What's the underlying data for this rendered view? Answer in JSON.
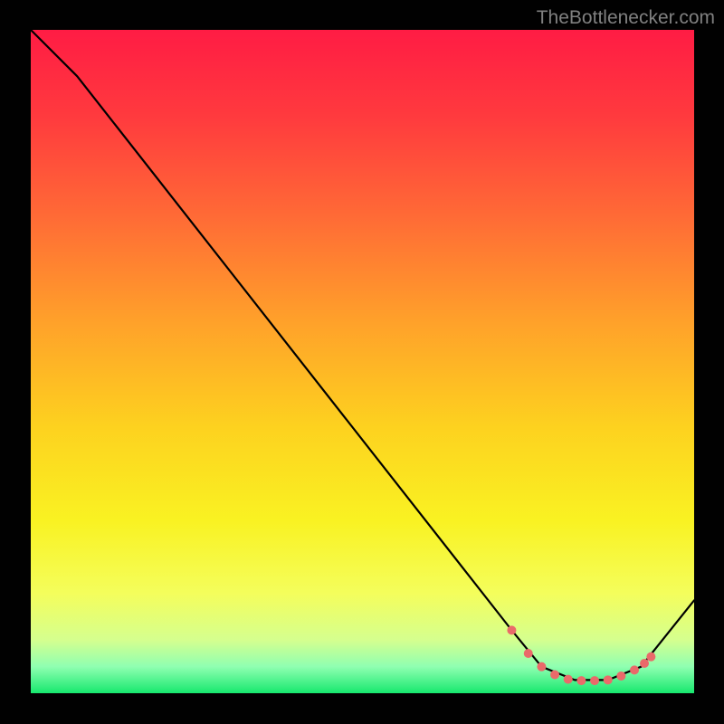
{
  "watermark": "TheBottlenecker.com",
  "chart_data": {
    "type": "line",
    "title": "",
    "xlabel": "",
    "ylabel": "",
    "xlim": [
      0,
      100
    ],
    "ylim": [
      0,
      100
    ],
    "series": [
      {
        "name": "curve",
        "x": [
          0,
          7,
          72.5,
          77,
          82,
          87,
          92,
          100
        ],
        "y": [
          100,
          93,
          9.5,
          4,
          2,
          2,
          4,
          14
        ]
      }
    ],
    "markers": {
      "name": "highlight-points",
      "color": "#ea6a6a",
      "x": [
        72.5,
        75,
        77,
        79,
        81,
        83,
        85,
        87,
        89,
        91,
        92.5,
        93.5
      ],
      "y": [
        9.5,
        6.0,
        4.0,
        2.8,
        2.1,
        1.9,
        1.9,
        2.0,
        2.6,
        3.5,
        4.5,
        5.5
      ]
    },
    "gradient": {
      "stops": [
        {
          "offset": 0.0,
          "color": "#ff1c44"
        },
        {
          "offset": 0.13,
          "color": "#ff3a3e"
        },
        {
          "offset": 0.28,
          "color": "#ff6a36"
        },
        {
          "offset": 0.44,
          "color": "#ffa12a"
        },
        {
          "offset": 0.6,
          "color": "#fdd21f"
        },
        {
          "offset": 0.74,
          "color": "#f9f222"
        },
        {
          "offset": 0.85,
          "color": "#f4fe5c"
        },
        {
          "offset": 0.92,
          "color": "#d5ff8f"
        },
        {
          "offset": 0.96,
          "color": "#8fffb1"
        },
        {
          "offset": 1.0,
          "color": "#17e86e"
        }
      ]
    }
  }
}
